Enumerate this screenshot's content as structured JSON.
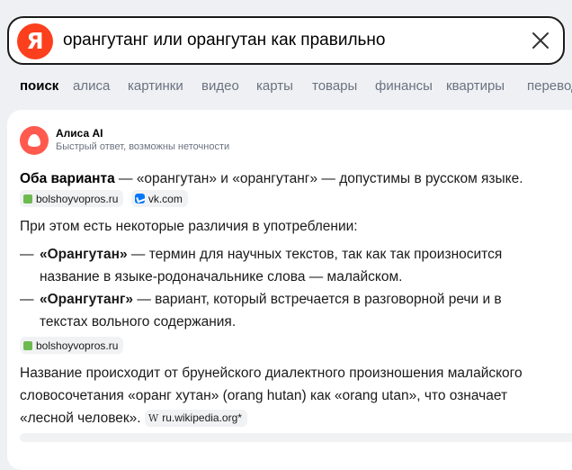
{
  "search": {
    "logo": "Я",
    "query": "орангутанг или орангутан как правильно"
  },
  "tabs": [
    {
      "label": "поиск",
      "active": true
    },
    {
      "label": "алиса"
    },
    {
      "label": "картинки"
    },
    {
      "label": "видео"
    },
    {
      "label": "карты"
    },
    {
      "label": "товары"
    },
    {
      "label": "финансы"
    },
    {
      "label": "квартиры"
    },
    {
      "label": "перевод"
    }
  ],
  "answer": {
    "source_name": "Алиса AI",
    "source_subtitle": "Быстрый ответ, возможны неточности",
    "p1_bold": "Оба варианта",
    "p1_rest": " — «орангутан» и «орангутанг» — допустимы в русском языке.",
    "p1_sources": [
      "bolshoyvopros.ru",
      "vk.com"
    ],
    "p2": "При этом есть некоторые различия в употреблении:",
    "list": [
      {
        "dash": "—",
        "bold": "«Орангутан»",
        "rest": " — термин для научных текстов, так как так произносится название в языке-родоначальнике слова — малайском."
      },
      {
        "dash": "—",
        "bold": "«Орангутанг»",
        "rest": " — вариант, который встречается в разговорной речи и в текстах вольного содержания."
      }
    ],
    "list_source": "bolshoyvopros.ru",
    "p3": "Название происходит от брунейского диалектного произношения малайского словосочетания «оранг хутан» (orang hutan) как «orang utan», что означает «лесной человек».",
    "p3_source_glyph": "W",
    "p3_source": "ru.wikipedia.org*"
  },
  "colors": {
    "logo": "#fc3f1d",
    "alice": "#ff5a4d",
    "chip_bg": "#f1f2f4",
    "page_bg": "#eef0f3"
  }
}
